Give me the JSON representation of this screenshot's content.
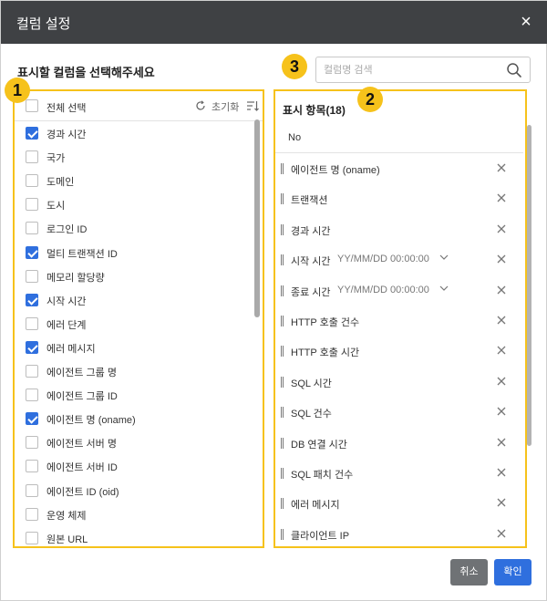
{
  "dialog": {
    "title": "컬럼 설정",
    "close": "×"
  },
  "left": {
    "section_title": "표시할 컬럼을 선택해주세요",
    "badge": "1",
    "select_all": "전체 선택",
    "reset": "초기화",
    "items": [
      {
        "label": "경과 시간",
        "checked": true
      },
      {
        "label": "국가",
        "checked": false
      },
      {
        "label": "도메인",
        "checked": false
      },
      {
        "label": "도시",
        "checked": false
      },
      {
        "label": "로그인 ID",
        "checked": false
      },
      {
        "label": "멀티 트랜잭션 ID",
        "checked": true
      },
      {
        "label": "메모리 할당량",
        "checked": false
      },
      {
        "label": "시작 시간",
        "checked": true
      },
      {
        "label": "에러 단계",
        "checked": false
      },
      {
        "label": "에러 메시지",
        "checked": true
      },
      {
        "label": "에이전트 그룹 명",
        "checked": false
      },
      {
        "label": "에이전트 그룹 ID",
        "checked": false
      },
      {
        "label": "에이전트 명 (oname)",
        "checked": true
      },
      {
        "label": "에이전트 서버 명",
        "checked": false
      },
      {
        "label": "에이전트 서버 ID",
        "checked": false
      },
      {
        "label": "에이전트 ID (oid)",
        "checked": false
      },
      {
        "label": "운영 체제",
        "checked": false
      },
      {
        "label": "원본 URL",
        "checked": false
      }
    ]
  },
  "search": {
    "placeholder": "컬럼명 검색",
    "value": "",
    "badge": "3"
  },
  "right": {
    "title": "표시 항목(18)",
    "badge": "2",
    "fixed": "No",
    "items": [
      {
        "label": "에이전트 명 (oname)",
        "format": ""
      },
      {
        "label": "트랜잭션",
        "format": ""
      },
      {
        "label": "경과 시간",
        "format": ""
      },
      {
        "label": "시작 시간",
        "format": "YY/MM/DD 00:00:00"
      },
      {
        "label": "종료 시간",
        "format": "YY/MM/DD 00:00:00"
      },
      {
        "label": "HTTP 호출 건수",
        "format": ""
      },
      {
        "label": "HTTP 호출 시간",
        "format": ""
      },
      {
        "label": "SQL 시간",
        "format": ""
      },
      {
        "label": "SQL 건수",
        "format": ""
      },
      {
        "label": "DB 연결 시간",
        "format": ""
      },
      {
        "label": "SQL 패치 건수",
        "format": ""
      },
      {
        "label": "에러 메시지",
        "format": ""
      },
      {
        "label": "클라이언트 IP",
        "format": ""
      }
    ]
  },
  "buttons": {
    "cancel": "취소",
    "ok": "확인"
  },
  "colors": {
    "accent": "#2f6fde",
    "highlight": "#f6c21b",
    "header": "#3f4144"
  }
}
